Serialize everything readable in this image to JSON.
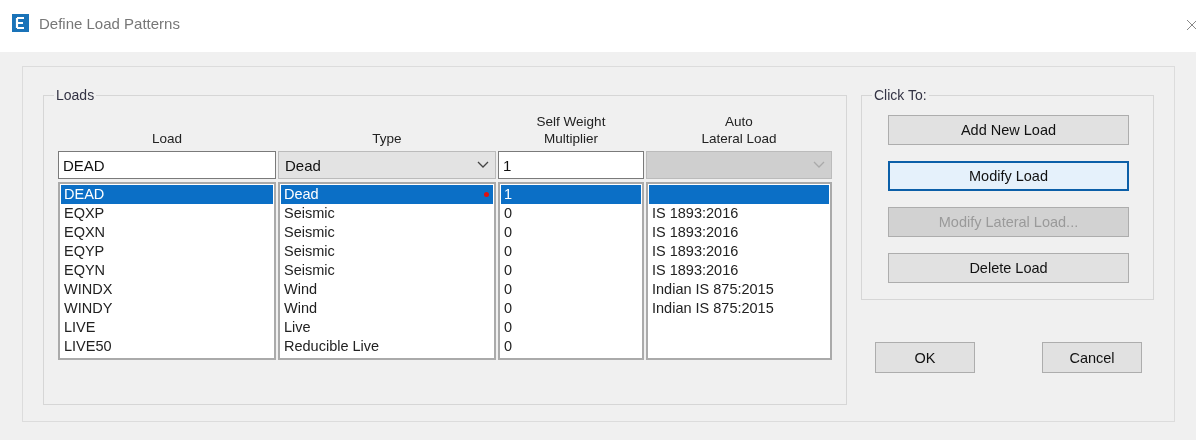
{
  "window": {
    "title": "Define Load Patterns"
  },
  "loads": {
    "title": "Loads",
    "columns": [
      "Load",
      "Type",
      "Self Weight\nMultiplier",
      "Auto\nLateral Load"
    ],
    "editor": {
      "load": "DEAD",
      "type": "Dead",
      "multiplier": "1",
      "auto_lateral_disabled": true
    },
    "rows": [
      {
        "load": "DEAD",
        "type": "Dead",
        "multiplier": "1",
        "selected": true,
        "flagged": true
      },
      {
        "load": "EQXP",
        "type": "Seismic",
        "multiplier": "0",
        "auto_lateral": "IS 1893:2016",
        "selected": false,
        "flagged": false
      },
      {
        "load": "EQXN",
        "type": "Seismic",
        "multiplier": "0",
        "auto_lateral": "IS 1893:2016",
        "selected": false,
        "flagged": false
      },
      {
        "load": "EQYP",
        "type": "Seismic",
        "multiplier": "0",
        "auto_lateral": "IS 1893:2016",
        "selected": false,
        "flagged": false
      },
      {
        "load": "EQYN",
        "type": "Seismic",
        "multiplier": "0",
        "auto_lateral": "IS 1893:2016",
        "selected": false,
        "flagged": false
      },
      {
        "load": "WINDX",
        "type": "Wind",
        "multiplier": "0",
        "auto_lateral": "Indian IS 875:2015",
        "selected": false,
        "flagged": false
      },
      {
        "load": "WINDY",
        "type": "Wind",
        "multiplier": "0",
        "auto_lateral": "Indian IS 875:2015",
        "selected": false,
        "flagged": false
      },
      {
        "load": "LIVE",
        "type": "Live",
        "multiplier": "0",
        "selected": false,
        "flagged": false
      },
      {
        "load": "LIVE50",
        "type": "Reducible Live",
        "multiplier": "0",
        "selected": false,
        "flagged": false
      }
    ]
  },
  "click_to": {
    "title": "Click To:",
    "buttons": [
      {
        "label": "Add New Load",
        "disabled": false,
        "focused": false
      },
      {
        "label": "Modify Load",
        "disabled": false,
        "focused": true
      },
      {
        "label": "Modify Lateral Load...",
        "disabled": true,
        "focused": false
      },
      {
        "label": "Delete Load",
        "disabled": false,
        "focused": false
      }
    ]
  },
  "dialog_buttons": [
    "OK",
    "Cancel"
  ]
}
